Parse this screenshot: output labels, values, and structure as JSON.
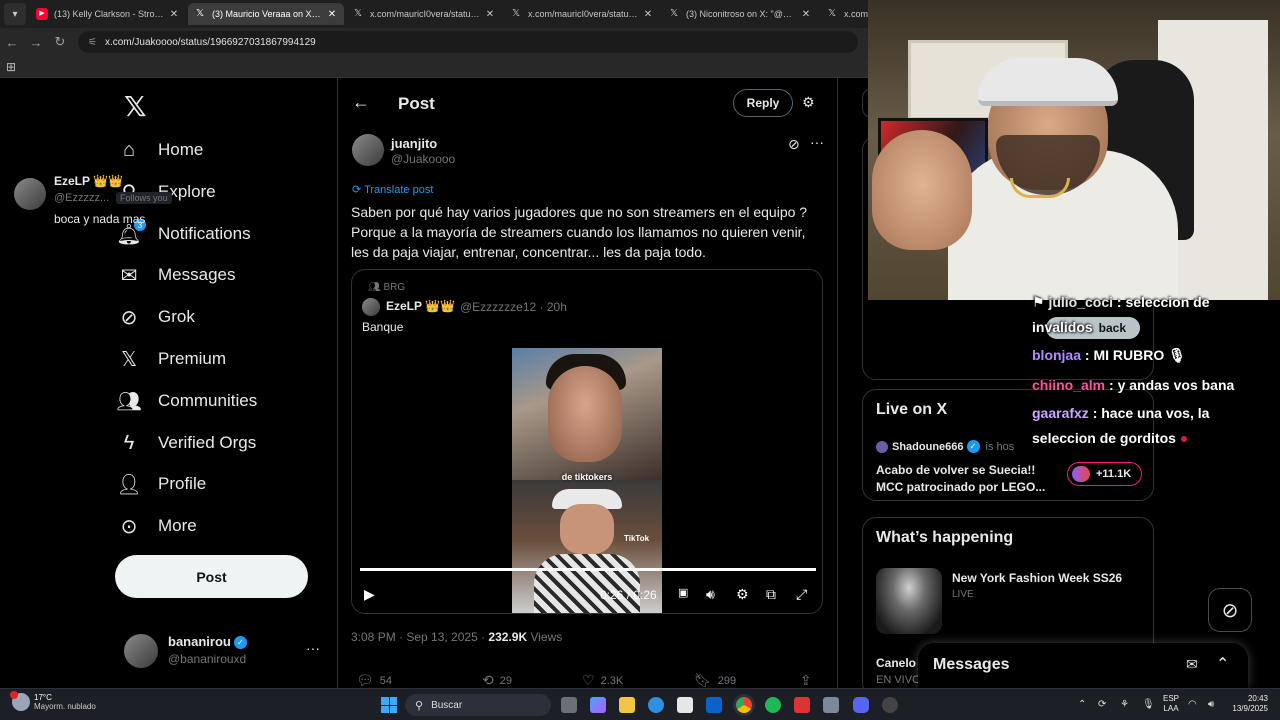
{
  "browser": {
    "tabs": [
      {
        "title": "(13) Kelly Clarkson - Stronger (W",
        "favicon": "youtube-icon",
        "active": false
      },
      {
        "title": "(3) Mauricio Veraaa on X: \"https:",
        "favicon": "x-icon",
        "active": true
      },
      {
        "title": "x.com/mauricI0vera/status/196",
        "favicon": "x-icon",
        "active": false
      },
      {
        "title": "x.com/mauricI0vera/status/196",
        "favicon": "x-icon",
        "active": false
      },
      {
        "title": "(3) Niconitroso on X: \"@banan",
        "favicon": "x-icon",
        "active": false
      },
      {
        "title": "x.com/m",
        "favicon": "x-icon",
        "active": false
      }
    ],
    "url": "x.com/Juakoooo/status/1966927031867994129"
  },
  "nav": {
    "items": [
      {
        "label": "Home",
        "icon": "home-icon"
      },
      {
        "label": "Explore",
        "icon": "search-icon"
      },
      {
        "label": "Notifications",
        "icon": "bell-icon",
        "badge": "3"
      },
      {
        "label": "Messages",
        "icon": "envelope-icon"
      },
      {
        "label": "Grok",
        "icon": "grok-icon"
      },
      {
        "label": "Premium",
        "icon": "x-icon"
      },
      {
        "label": "Communities",
        "icon": "people-icon"
      },
      {
        "label": "Verified Orgs",
        "icon": "lightning-icon"
      },
      {
        "label": "Profile",
        "icon": "person-icon"
      },
      {
        "label": "More",
        "icon": "more-circle-icon"
      }
    ],
    "post_label": "Post",
    "account": {
      "name": "bananirou",
      "handle": "@bananirouxd"
    }
  },
  "header": {
    "title": "Post",
    "reply_label": "Reply"
  },
  "tweet": {
    "author_name": "juanjito",
    "author_handle": "@Juakoooo",
    "translate_label": "Translate post",
    "lines": [
      "Saben por qué hay varios jugadores que no son streamers en el equipo ?",
      "Porque a la mayoría de streamers cuando los llamamos no quieren venir,",
      "les da paja viajar, entrenar, concentrar... les da paja todo."
    ],
    "time": "3:08 PM · Sep 13, 2025 · ",
    "views_count": "232.9K",
    "views_label": " Views",
    "stats": {
      "replies": "54",
      "reposts": "29",
      "likes": "2.3K",
      "bookmarks": "299"
    }
  },
  "quote": {
    "community": "BRG",
    "author_name": "EzeLP",
    "author_handle": "@Ezzzzzze12 · 20h",
    "text": "Banque",
    "video_caption": "de tiktokers",
    "video_watermark": "TikTok",
    "video_time": "0:26 / 0:26",
    "progress": 1.0
  },
  "sidebar": {
    "reply": {
      "name": "EzeLP",
      "handle": "@Ezzzzz...",
      "follows": "Follows you",
      "text": "boca y nada mas"
    },
    "live": {
      "title": "Live on X",
      "host": "Shadoune666",
      "host_suffix": "is hos",
      "description": "Acabo de volver se Suecia!! MCC patrocinado por LEGO...",
      "count": "+11.1K"
    },
    "trends": {
      "title": "What’s happening",
      "item1_title": "New York Fashion Week SS26",
      "item1_sub": "LIVE",
      "item2_title": "Canelo",
      "item2_sub": "EN VIVO"
    },
    "messages_label": "Messages"
  },
  "chat": [
    {
      "user": "julio_coci",
      "message": " : seleccion de",
      "color": "#e6e6e6"
    },
    {
      "user": "",
      "message": "invalidos",
      "color": "#ffffff"
    },
    {
      "user": "blonjaa",
      "message": " : MI RUBRO",
      "color": "#b18cff"
    },
    {
      "user": "chiino_alm",
      "message": " : y andas vos bana",
      "color": "#ff4fa3"
    },
    {
      "user": "gaarafxz",
      "message": " : hace una vos, la",
      "color": "#c8a8ff"
    },
    {
      "user": "",
      "message": "seleccion de gorditos",
      "color": "#ffffff"
    }
  ],
  "chat_back_label": "back",
  "taskbar": {
    "temp": "17°C",
    "weather": "Mayorm. nublado",
    "search": "Buscar",
    "lang1": "ESP",
    "lang2": "LAA",
    "time": "20:43",
    "date": "13/9/2025"
  }
}
